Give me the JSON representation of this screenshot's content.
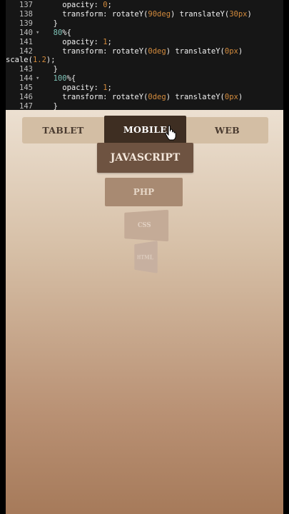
{
  "editor": {
    "lines": [
      {
        "num": "137",
        "fold": "",
        "parts": [
          [
            "kw",
            "    opacity: "
          ],
          [
            "num",
            "0"
          ],
          [
            "kw",
            ";"
          ]
        ]
      },
      {
        "num": "138",
        "fold": "",
        "parts": [
          [
            "kw",
            "    transform: rotateY("
          ],
          [
            "num",
            "90deg"
          ],
          [
            "kw",
            ") translateY("
          ],
          [
            "num",
            "30px"
          ],
          [
            "kw",
            ")"
          ]
        ]
      },
      {
        "num": "139",
        "fold": "",
        "parts": [
          [
            "kw",
            "  }"
          ]
        ]
      },
      {
        "num": "140",
        "fold": "▾",
        "parts": [
          [
            "pct",
            "  80"
          ],
          [
            "kw",
            "%{"
          ]
        ]
      },
      {
        "num": "141",
        "fold": "",
        "parts": [
          [
            "kw",
            "    opacity: "
          ],
          [
            "num",
            "1"
          ],
          [
            "kw",
            ";"
          ]
        ]
      },
      {
        "num": "142",
        "fold": "",
        "parts": [
          [
            "kw",
            "    transform: rotateY("
          ],
          [
            "num",
            "0deg"
          ],
          [
            "kw",
            ") translateY("
          ],
          [
            "num",
            "0px"
          ],
          [
            "kw",
            ")"
          ]
        ]
      },
      {
        "num": "",
        "fold": "",
        "parts": [
          [
            "kw",
            "scale("
          ],
          [
            "num",
            "1.2"
          ],
          [
            "kw",
            ");"
          ]
        ],
        "indent": -54
      },
      {
        "num": "143",
        "fold": "",
        "parts": [
          [
            "kw",
            "  }"
          ]
        ]
      },
      {
        "num": "144",
        "fold": "▾",
        "parts": [
          [
            "pct",
            "  100"
          ],
          [
            "kw",
            "%{"
          ]
        ]
      },
      {
        "num": "145",
        "fold": "",
        "parts": [
          [
            "kw",
            "    opacity: "
          ],
          [
            "num",
            "1"
          ],
          [
            "kw",
            ";"
          ]
        ]
      },
      {
        "num": "146",
        "fold": "",
        "parts": [
          [
            "kw",
            "    transform: rotateY("
          ],
          [
            "num",
            "0deg"
          ],
          [
            "kw",
            ") translateY("
          ],
          [
            "num",
            "0px"
          ],
          [
            "kw",
            ")"
          ]
        ]
      },
      {
        "num": "147",
        "fold": "",
        "parts": [
          [
            "kw",
            "  }"
          ]
        ]
      }
    ]
  },
  "tabs": {
    "tablet": "TABLET",
    "mobile": "MOBILE",
    "web": "WEB"
  },
  "cards": {
    "javascript": "JAVASCRIPT",
    "php": "PHP",
    "css": "CSS",
    "html": "HTML"
  },
  "cursor_icon": "hand-pointer-icon"
}
